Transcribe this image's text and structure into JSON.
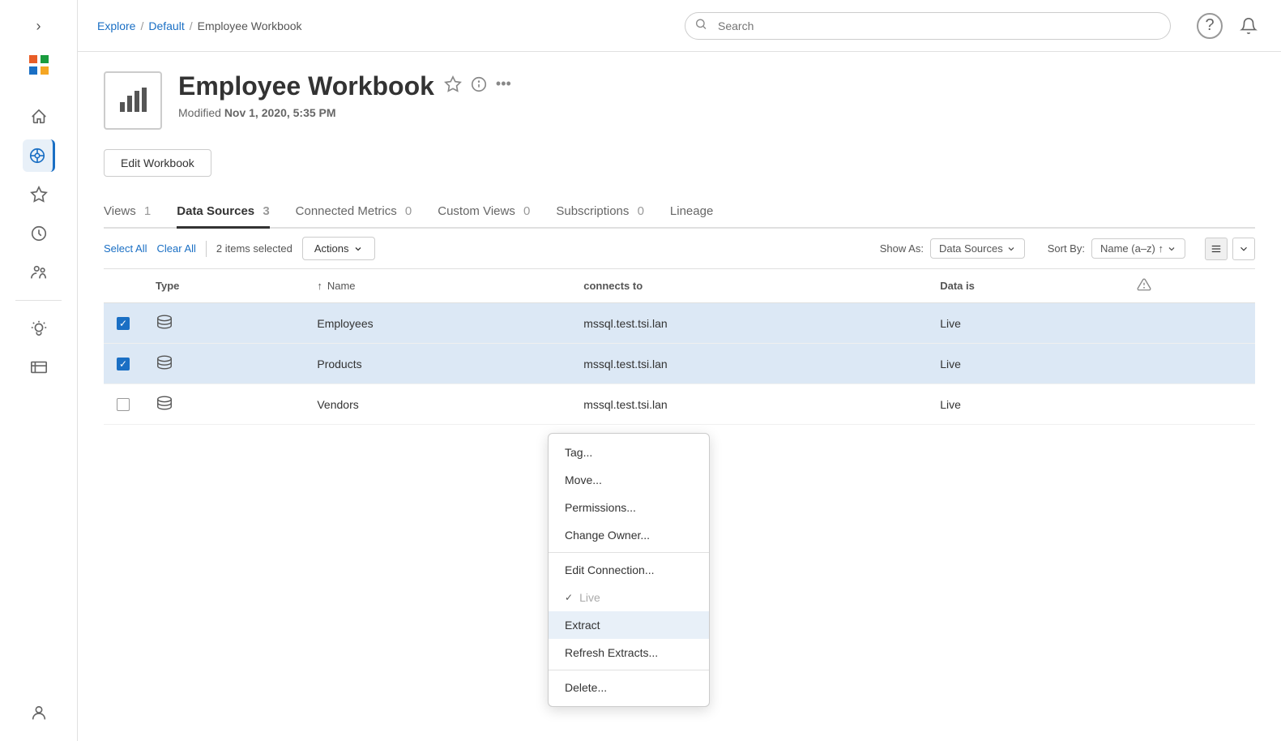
{
  "sidebar": {
    "toggle_icon": "›",
    "logo_icon": "✦",
    "items": [
      {
        "name": "home",
        "icon": "⌂",
        "active": false
      },
      {
        "name": "explore",
        "icon": "◉",
        "active": true
      },
      {
        "name": "favorites",
        "icon": "☆",
        "active": false
      },
      {
        "name": "recents",
        "icon": "⟳",
        "active": false
      },
      {
        "name": "users",
        "icon": "👥",
        "active": false
      },
      {
        "name": "ideas",
        "icon": "💡",
        "active": false
      },
      {
        "name": "collections",
        "icon": "🗄",
        "active": false
      }
    ],
    "bottom_item": {
      "name": "people",
      "icon": "👤"
    }
  },
  "header": {
    "breadcrumb": {
      "explore": "Explore",
      "default": "Default",
      "current": "Employee Workbook"
    },
    "search_placeholder": "Search",
    "help_label": "?",
    "bell_label": "🔔"
  },
  "workbook": {
    "icon": "📊",
    "title": "Employee Workbook",
    "star_icon": "☆",
    "info_icon": "ⓘ",
    "more_icon": "•••",
    "modified_label": "Modified",
    "modified_date": "Nov 1, 2020, 5:35 PM",
    "edit_button": "Edit Workbook"
  },
  "tabs": [
    {
      "label": "Views",
      "count": "1",
      "active": false
    },
    {
      "label": "Data Sources",
      "count": "3",
      "active": true
    },
    {
      "label": "Connected Metrics",
      "count": "0",
      "active": false
    },
    {
      "label": "Custom Views",
      "count": "0",
      "active": false
    },
    {
      "label": "Subscriptions",
      "count": "0",
      "active": false
    },
    {
      "label": "Lineage",
      "count": "",
      "active": false
    }
  ],
  "toolbar": {
    "select_all": "Select All",
    "clear_all": "Clear All",
    "items_selected": "2 items selected",
    "actions_label": "Actions",
    "show_as_label": "Show As:",
    "show_as_value": "Data Sources",
    "sort_by_label": "Sort By:",
    "sort_by_value": "Name (a–z) ↑"
  },
  "table": {
    "columns": [
      "",
      "Type",
      "Name",
      "connects to",
      "Data is",
      "⚠"
    ],
    "rows": [
      {
        "checked": true,
        "name": "Employees",
        "connects_to": "mssql.test.tsi.lan",
        "data_is": "Live",
        "warning": false
      },
      {
        "checked": true,
        "name": "Products",
        "connects_to": "mssql.test.tsi.lan",
        "data_is": "Live",
        "warning": false
      },
      {
        "checked": false,
        "name": "Vendors",
        "connects_to": "mssql.test.tsi.lan",
        "data_is": "Live",
        "warning": false
      }
    ]
  },
  "actions_menu": {
    "items": [
      {
        "label": "Tag...",
        "group": 1,
        "highlighted": false,
        "disabled": false,
        "divider_before": false
      },
      {
        "label": "Move...",
        "group": 1,
        "highlighted": false,
        "disabled": false,
        "divider_before": false
      },
      {
        "label": "Permissions...",
        "group": 1,
        "highlighted": false,
        "disabled": false,
        "divider_before": false
      },
      {
        "label": "Change Owner...",
        "group": 1,
        "highlighted": false,
        "disabled": false,
        "divider_before": false
      },
      {
        "label": "Edit Connection...",
        "group": 2,
        "highlighted": false,
        "disabled": false,
        "divider_before": true
      },
      {
        "label": "Live",
        "group": 2,
        "highlighted": false,
        "disabled": true,
        "check": true,
        "divider_before": false
      },
      {
        "label": "Extract",
        "group": 2,
        "highlighted": true,
        "disabled": false,
        "divider_before": false
      },
      {
        "label": "Refresh Extracts...",
        "group": 2,
        "highlighted": false,
        "disabled": false,
        "divider_before": false
      },
      {
        "label": "Delete...",
        "group": 3,
        "highlighted": false,
        "disabled": false,
        "divider_before": true
      }
    ]
  }
}
